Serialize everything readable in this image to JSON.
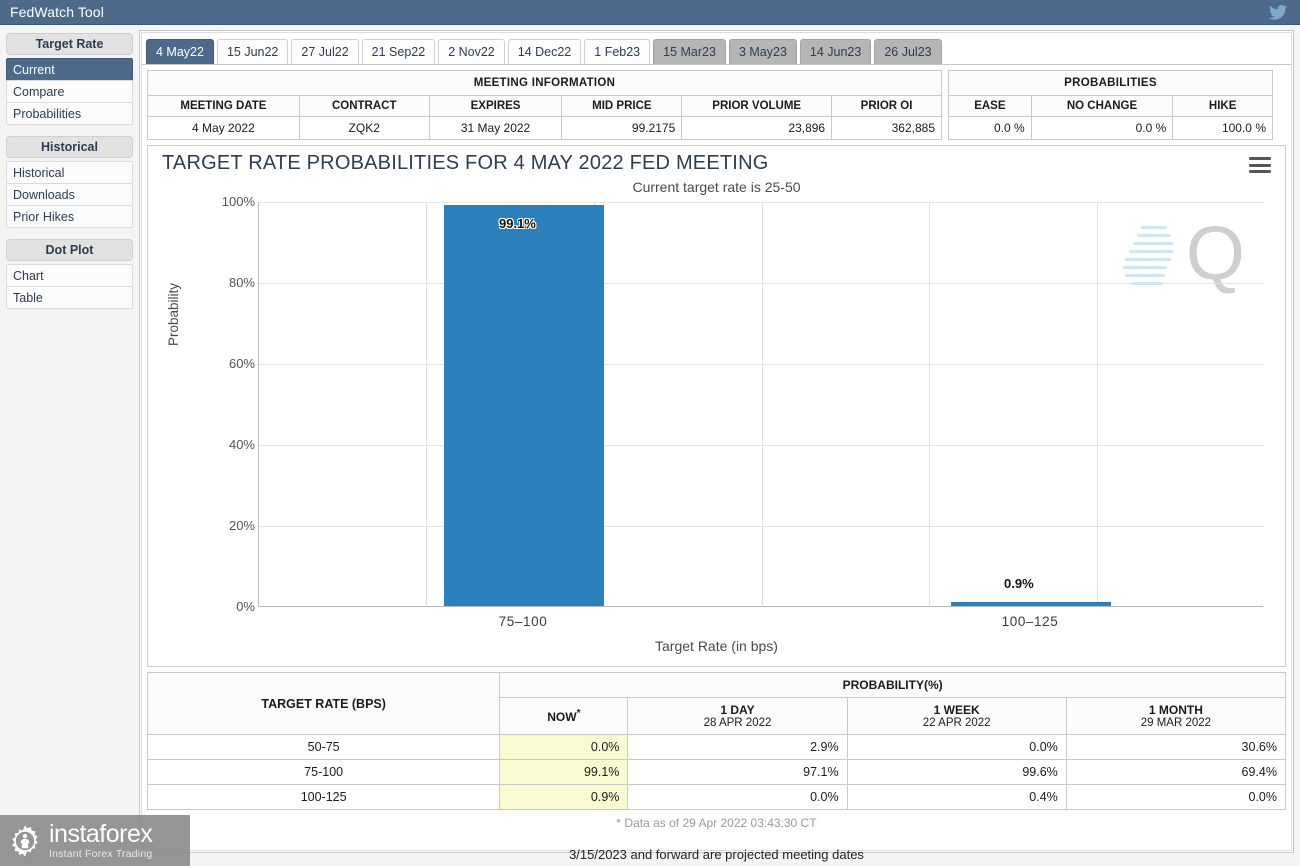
{
  "header": {
    "title": "FedWatch Tool",
    "twitter_icon": "twitter-icon"
  },
  "sidebar": {
    "groups": [
      {
        "label": "Target Rate",
        "items": [
          {
            "label": "Current",
            "active": true
          },
          {
            "label": "Compare",
            "active": false
          },
          {
            "label": "Probabilities",
            "active": false
          }
        ]
      },
      {
        "label": "Historical",
        "items": [
          {
            "label": "Historical",
            "active": false
          },
          {
            "label": "Downloads",
            "active": false
          },
          {
            "label": "Prior Hikes",
            "active": false
          }
        ]
      },
      {
        "label": "Dot Plot",
        "items": [
          {
            "label": "Chart",
            "active": false
          },
          {
            "label": "Table",
            "active": false
          }
        ]
      }
    ]
  },
  "tabs": [
    {
      "label": "4 May22",
      "state": "active"
    },
    {
      "label": "15 Jun22",
      "state": "normal"
    },
    {
      "label": "27 Jul22",
      "state": "normal"
    },
    {
      "label": "21 Sep22",
      "state": "normal"
    },
    {
      "label": "2 Nov22",
      "state": "normal"
    },
    {
      "label": "14 Dec22",
      "state": "normal"
    },
    {
      "label": "1 Feb23",
      "state": "normal"
    },
    {
      "label": "15 Mar23",
      "state": "projected"
    },
    {
      "label": "3 May23",
      "state": "projected"
    },
    {
      "label": "14 Jun23",
      "state": "projected"
    },
    {
      "label": "26 Jul23",
      "state": "projected"
    }
  ],
  "meeting_information": {
    "group_title": "MEETING INFORMATION",
    "columns": [
      "MEETING DATE",
      "CONTRACT",
      "EXPIRES",
      "MID PRICE",
      "PRIOR VOLUME",
      "PRIOR OI"
    ],
    "row": {
      "meeting_date": "4 May 2022",
      "contract": "ZQK2",
      "expires": "31 May 2022",
      "mid_price": "99.2175",
      "prior_volume": "23,896",
      "prior_oi": "362,885"
    }
  },
  "probabilities_summary": {
    "group_title": "PROBABILITIES",
    "columns": [
      "EASE",
      "NO CHANGE",
      "HIKE"
    ],
    "row": {
      "ease": "0.0 %",
      "no_change": "0.0 %",
      "hike": "100.0 %"
    }
  },
  "chart_data": {
    "type": "bar",
    "title": "TARGET RATE PROBABILITIES FOR 4 MAY 2022 FED MEETING",
    "subtitle": "Current target rate is 25-50",
    "categories": [
      "75-100",
      "100-125"
    ],
    "category_display": [
      "75–100",
      "100–125"
    ],
    "values": [
      99.1,
      0.9
    ],
    "data_labels": [
      "99.1%",
      "0.9%"
    ],
    "xlabel": "Target Rate (in bps)",
    "ylabel": "Probability",
    "ylim": [
      0,
      100
    ],
    "yticks": [
      0,
      20,
      40,
      60,
      80,
      100
    ],
    "ytick_labels": [
      "0%",
      "20%",
      "40%",
      "60%",
      "80%",
      "100%"
    ],
    "grid": true,
    "legend": null,
    "bar_color": "#2b7fba",
    "menu_icon": "hamburger-menu-icon",
    "watermark": "Q"
  },
  "probability_table": {
    "rate_header": "TARGET RATE (BPS)",
    "group_header": "PROBABILITY(%)",
    "columns": [
      {
        "label": "NOW",
        "superscript": "*",
        "date": ""
      },
      {
        "label": "1 DAY",
        "superscript": "",
        "date": "28 APR 2022"
      },
      {
        "label": "1 WEEK",
        "superscript": "",
        "date": "22 APR 2022"
      },
      {
        "label": "1 MONTH",
        "superscript": "",
        "date": "29 MAR 2022"
      }
    ],
    "rows": [
      {
        "rate": "50-75",
        "now": "0.0%",
        "day": "2.9%",
        "week": "0.0%",
        "month": "30.6%"
      },
      {
        "rate": "75-100",
        "now": "99.1%",
        "day": "97.1%",
        "week": "99.6%",
        "month": "69.4%"
      },
      {
        "rate": "100-125",
        "now": "0.9%",
        "day": "0.0%",
        "week": "0.4%",
        "month": "0.0%"
      }
    ],
    "footnote": "* Data as of 29 Apr 2022 03:43:30 CT"
  },
  "projected_note": "3/15/2023 and forward are projected meeting dates",
  "branding": {
    "name": "instaforex",
    "tagline": "Instant Forex Trading",
    "gear_icon": "instaforex-gear-icon"
  },
  "colors": {
    "header": "#4d6a8a",
    "accent": "#2b7fba",
    "now_highlight": "#fafad2",
    "projected_tab": "#b5b5b5"
  }
}
